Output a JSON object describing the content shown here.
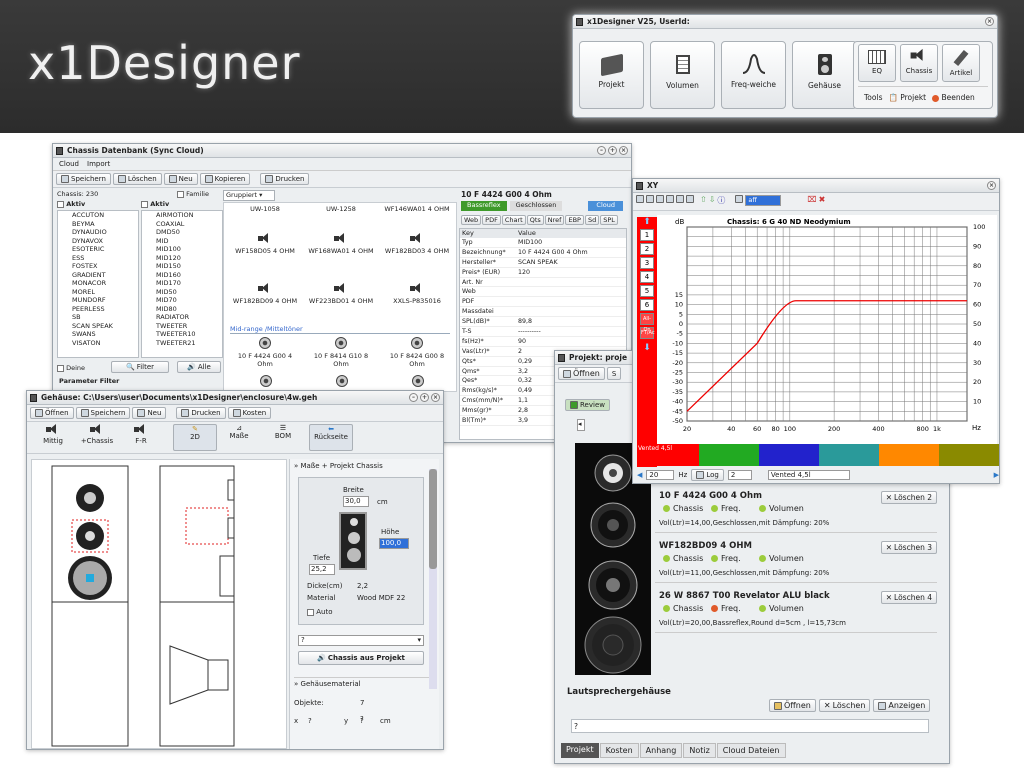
{
  "banner": {
    "logo": "x1Designer"
  },
  "main": {
    "title": "x1Designer V25, UserId:",
    "buttons": [
      "Projekt",
      "Volumen",
      "Freq-weiche",
      "Gehäuse"
    ],
    "small_buttons": [
      "EQ",
      "Chassis",
      "Artikel"
    ],
    "links": [
      "Tools",
      "Projekt",
      "Beenden"
    ]
  },
  "chassis_db": {
    "title": "Chassis Datenbank (Sync Cloud)",
    "menu": [
      "Cloud",
      "Import"
    ],
    "toolbar": [
      "Speichern",
      "Löschen",
      "Neu",
      "Kopieren",
      "Drucken"
    ],
    "count": "Chassis: 230",
    "familie": "Familie",
    "aktiv": "Aktiv",
    "brands": [
      "ACCUTON",
      "BEYMA",
      "DYNAUDIO",
      "DYNAVOX",
      "ESOTERIC",
      "ESS",
      "FOSTEX",
      "GRADIENT",
      "MONACOR",
      "MOREL",
      "MUNDORF",
      "PEERLESS",
      "SB",
      "SCAN SPEAK",
      "SWANS",
      "VISATON"
    ],
    "types": [
      "AIRMOTION",
      "COAXIAL",
      "DMD50",
      "MID",
      "MID100",
      "MID120",
      "MID150",
      "MID160",
      "MID170",
      "MID50",
      "MID70",
      "MID80",
      "RADIATOR",
      "TWEETER",
      "TWEETER10",
      "TWEETER21"
    ],
    "deine": "Deine",
    "filter": "Filter",
    "alle": "Alle",
    "param": "Parameter Filter",
    "group": "Gruppiert",
    "grid_top": [
      "UW-1058",
      "UW-1258",
      "WF146WA01 4 OHM"
    ],
    "grid_row1": [
      "WF158D05 4 OHM",
      "WF168WA01 4 OHM",
      "WF182BD03 4 OHM"
    ],
    "grid_row2": [
      "WF182BD09 4 OHM",
      "WF223BD01 4 OHM",
      "XXLS-P835016"
    ],
    "section": "Mid-range /Mitteltöner",
    "grid_row3": [
      "10 F 4424 G00 4 Ohm",
      "10 F 8414 G10 8 Ohm",
      "10 F 8424 G00 8 Ohm"
    ],
    "detail_title": "10 F 4424 G00 4 Ohm",
    "bassreflex": "Bassreflex",
    "geschlossen": "Geschlossen",
    "cloud": "Cloud",
    "detail_tabs": [
      "Web",
      "PDF",
      "Chart",
      "Qts",
      "Nref",
      "EBP",
      "Sd",
      "SPL"
    ],
    "key_head": "Key",
    "val_head": "Value",
    "kv": [
      [
        "Typ",
        "MID100"
      ],
      [
        "Bezeichnung*",
        "10 F 4424 G00 4 Ohm"
      ],
      [
        "Hersteller*",
        "SCAN SPEAK"
      ],
      [
        "Preis* (EUR)",
        "120"
      ],
      [
        "Art. Nr",
        ""
      ],
      [
        "Web",
        ""
      ],
      [
        "PDF",
        ""
      ],
      [
        "Massdatei",
        ""
      ],
      [
        "SPL(dB)*",
        "89,8"
      ],
      [
        "T-S",
        "----------"
      ],
      [
        "fs(Hz)*",
        "90"
      ],
      [
        "Vas(Ltr)*",
        "2"
      ],
      [
        "Qts*",
        "0,29"
      ],
      [
        "Qms*",
        "3,2"
      ],
      [
        "Qes*",
        "0,32"
      ],
      [
        "Rms(kg/s)*",
        "0,49"
      ],
      [
        "Cms(mm/N)*",
        "1,1"
      ],
      [
        "Mms(gr)*",
        "2,8"
      ],
      [
        "Bl(Tm)*",
        "3,9"
      ]
    ]
  },
  "xy": {
    "title": "XY",
    "sel": "aff",
    "chart_title": "Chassis: 6 G 40 ND Neodymium",
    "left_buttons": [
      "1",
      "2",
      "3",
      "4",
      "5",
      "6",
      "All-On",
      "FT/Ac"
    ],
    "legend": "Vented 4,5l",
    "hz_val": "20",
    "hz": "Hz",
    "log": "Log",
    "num": "2",
    "vented": "Vented 4,5l"
  },
  "projekt": {
    "title": "Projekt: proje",
    "oeffnen": "Öffnen",
    "review": "Review",
    "items": [
      {
        "name": "10 F 4424 G00 4 Ohm",
        "loeschen": "Löschen 2",
        "desc": "Vol(Ltr)=14,00,Geschlossen,mit Dämpfung: 20%",
        "freq_color": "#9ccc3c"
      },
      {
        "name": "WF182BD09 4 OHM",
        "loeschen": "Löschen 3",
        "desc": "Vol(Ltr)=11,00,Geschlossen,mit Dämpfung: 20%",
        "freq_color": "#9ccc3c"
      },
      {
        "name": "26 W 8867 T00 Revelator ALU black",
        "loeschen": "Löschen 4",
        "desc": "Vol(Ltr)=20,00,Bassreflex,Round d=5cm , l=15,73cm",
        "freq_color": "#e05a2a"
      }
    ],
    "chassis": "Chassis",
    "freq": "Freq.",
    "volumen": "Volumen",
    "lsg": "Lautsprechergehäuse",
    "btns": [
      "Öffnen",
      "Löschen",
      "Anzeigen"
    ],
    "q": "?",
    "tabs": [
      "Projekt",
      "Kosten",
      "Anhang",
      "Notiz",
      "Cloud Dateien"
    ]
  },
  "gehaeuse": {
    "title": "Gehäuse: C:\\Users\\user\\Documents\\x1Designer\\enclosure\\4w.geh",
    "toolbar": [
      "Öffnen",
      "Speichern",
      "Neu",
      "Drucken",
      "Kosten"
    ],
    "tools": [
      "Mittig",
      "+Chassis",
      "F-R",
      "2D",
      "Maße",
      "BOM",
      "Rückseite"
    ],
    "panel_title": "Maße + Projekt Chassis",
    "breite": "Breite",
    "breite_val": "30,0",
    "cm": "cm",
    "hoehe": "Höhe",
    "hoehe_val": "100,0",
    "tiefe": "Tiefe",
    "tiefe_val": "25,2",
    "dicke": "Dicke(cm)",
    "dicke_val": "2,2",
    "material": "Material",
    "material_val": "Wood MDF 22",
    "auto": "Auto",
    "q": "?",
    "cap": "Chassis aus Projekt",
    "material_head": "Gehäusematerial",
    "objekte": "Objekte:",
    "objekte_val": "7",
    "q2": "?",
    "x": "x",
    "xq": "?",
    "y": "y",
    "yq": "?",
    "cm2": "cm"
  }
}
